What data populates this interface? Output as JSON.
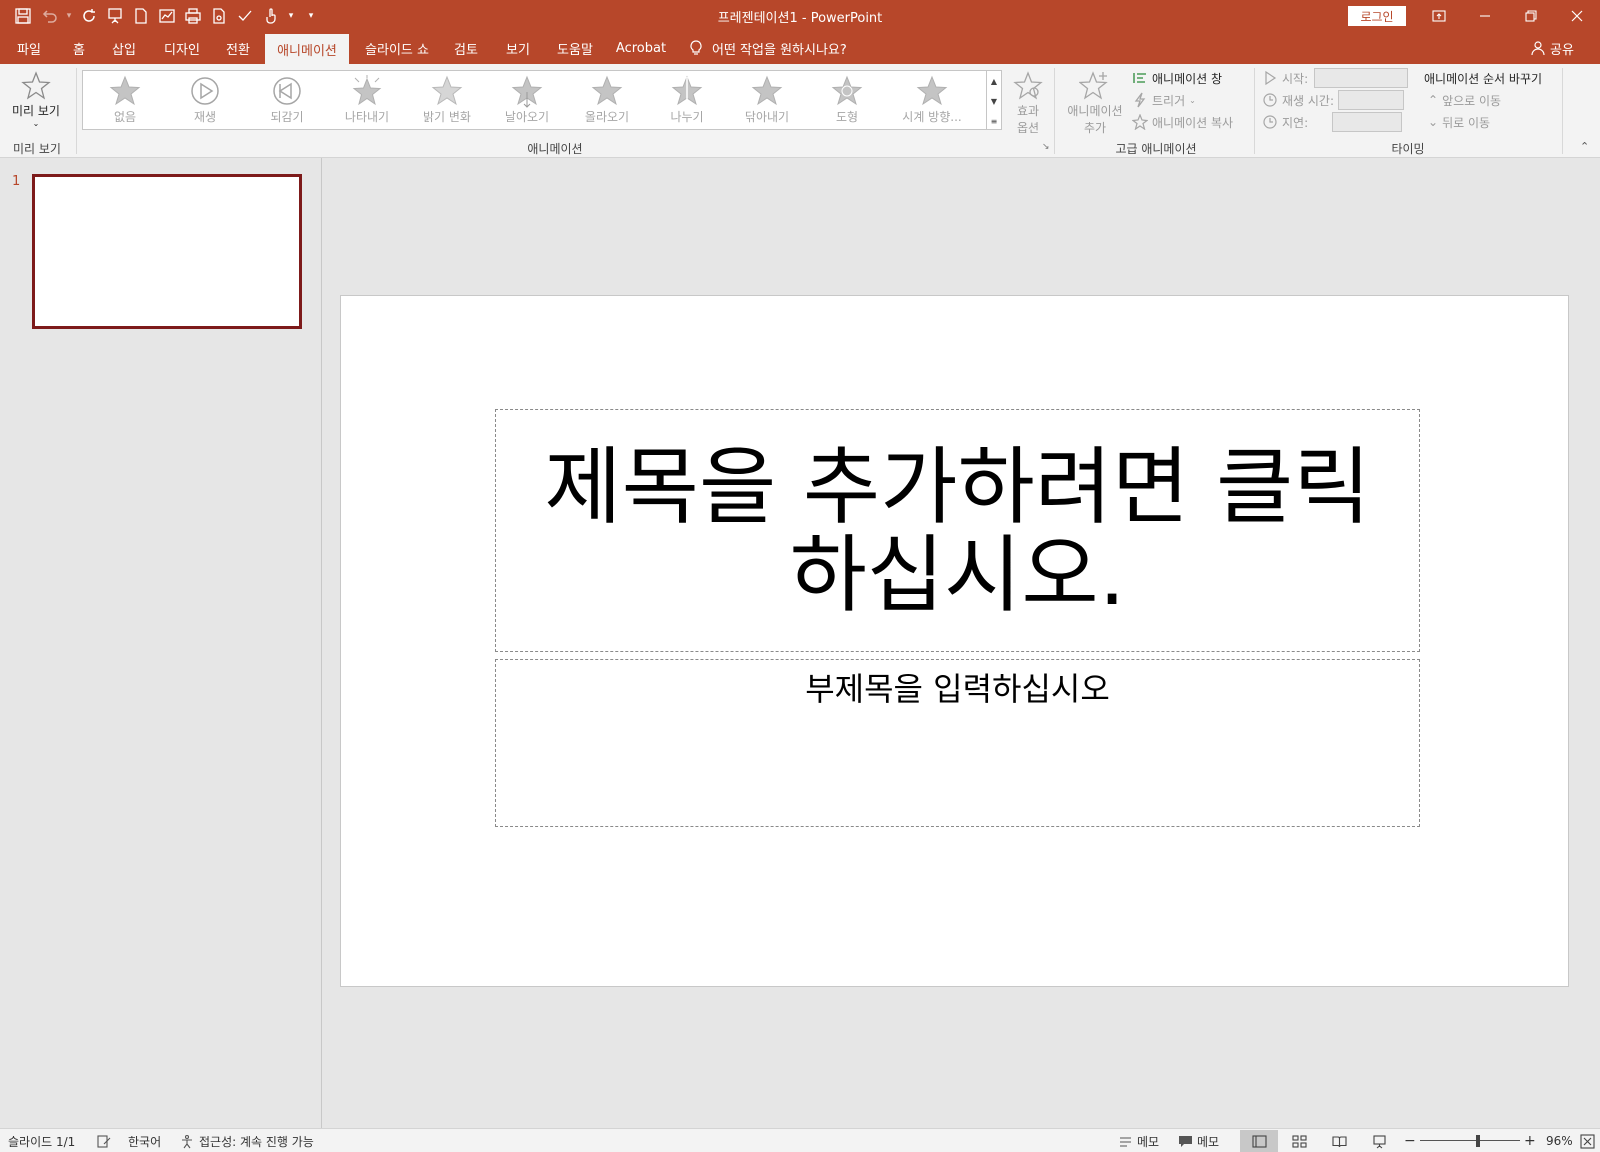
{
  "app": {
    "title": "프레젠테이션1  -  PowerPoint",
    "login": "로그인",
    "accent": "#b7472a"
  },
  "qat": {
    "icons": [
      "save-icon",
      "undo-icon",
      "redo-icon",
      "presentation-icon",
      "new-file-icon",
      "chart-icon",
      "print-icon",
      "open-file-icon",
      "spelling-icon",
      "touch-mode-icon",
      "customize-icon"
    ]
  },
  "tabs": [
    {
      "label": "파일"
    },
    {
      "label": "홈"
    },
    {
      "label": "삽입"
    },
    {
      "label": "디자인"
    },
    {
      "label": "전환"
    },
    {
      "label": "애니메이션",
      "active": true
    },
    {
      "label": "슬라이드 쇼"
    },
    {
      "label": "검토"
    },
    {
      "label": "보기"
    },
    {
      "label": "도움말"
    },
    {
      "label": "Acrobat"
    }
  ],
  "tellme": "어떤 작업을 원하시나요?",
  "share": "공유",
  "ribbon": {
    "preview": {
      "button": "미리 보기",
      "group": "미리 보기"
    },
    "animation": {
      "group": "애니메이션",
      "items": [
        "없음",
        "재생",
        "되감기",
        "나타내기",
        "밝기 변화",
        "날아오기",
        "올라오기",
        "나누기",
        "닦아내기",
        "도형",
        "시계 방향..."
      ],
      "effect_options_line1": "효과",
      "effect_options_line2": "옵션"
    },
    "advanced": {
      "group": "고급 애니메이션",
      "add_line1": "애니메이션",
      "add_line2": "추가",
      "pane": "애니메이션 창",
      "trigger": "트리거",
      "painter": "애니메이션 복사"
    },
    "timing": {
      "group": "타이밍",
      "start": "시작:",
      "duration": "재생 시간:",
      "delay": "지연:",
      "reorder": "애니메이션 순서 바꾸기",
      "move_earlier": "앞으로 이동",
      "move_later": "뒤로 이동"
    }
  },
  "thumbnails": {
    "number": "1"
  },
  "slide": {
    "title": "제목을 추가하려면 클릭하십시오.",
    "subtitle": "부제목을 입력하십시오"
  },
  "status": {
    "slide": "슬라이드 1/1",
    "language": "한국어",
    "accessibility": "접근성: 계속 진행 가능",
    "notes": "메모",
    "comments": "메모",
    "zoom": "96%",
    "zoom_minus": "−",
    "zoom_plus": "+",
    "zoom_level": 0.58
  }
}
